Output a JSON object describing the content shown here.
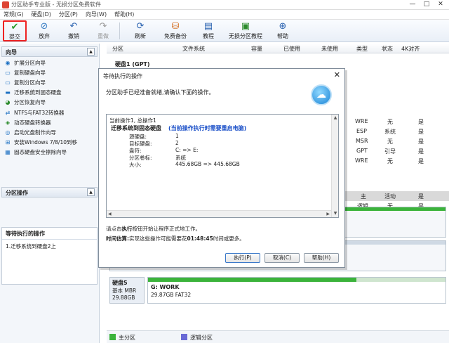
{
  "window": {
    "title": "分区助手专业版 - 无损分区免费软件",
    "controls": [
      "—",
      "□",
      "✕"
    ]
  },
  "menu": [
    "常规(G)",
    "硬盘(D)",
    "分区(P)",
    "向导(W)",
    "帮助(H)"
  ],
  "toolbar": {
    "commit": "提交",
    "discard": "放弃",
    "undo": "撤销",
    "redo": "重做",
    "refresh": "刷新",
    "free_backup": "免费备份",
    "tutorial": "教程",
    "lossless_tutorial": "无损分区教程",
    "help": "帮助"
  },
  "sidebar": {
    "wizard_title": "向导",
    "wizard_items": [
      "扩展分区向导",
      "复制硬盘向导",
      "复制分区向导",
      "迁移系统到固态硬盘",
      "分区恢复向导",
      "NTFS与FAT32转换器",
      "动态硬盘转换器",
      "启动光盘制作向导",
      "安装Windows 7/8/10到移",
      "固态硬盘安全擦除向导"
    ],
    "partition_ops_title": "分区操作",
    "pending_title": "等待执行的操作",
    "pending_items": [
      "1.迁移系统到硬盘2上"
    ]
  },
  "table": {
    "headers": [
      "分区",
      "文件系统",
      "容量",
      "已使用",
      "未使用",
      "类型",
      "状态",
      "4K对齐"
    ],
    "disk_label": "硬盘1 (GPT)",
    "rows": [
      [
        "WRE",
        "无",
        "是"
      ],
      [
        "ESP",
        "系统",
        "是"
      ],
      [
        "MSR",
        "无",
        "是"
      ],
      [
        "GPT",
        "引导",
        "是"
      ],
      [
        "WRE",
        "无",
        "是"
      ],
      [
        "",
        "",
        ""
      ],
      [
        "",
        "",
        ""
      ],
      [
        "主",
        "活动",
        "是"
      ],
      [
        "逻辑",
        "无",
        "是"
      ],
      [
        "",
        "",
        "是"
      ],
      [
        "",
        "",
        "是"
      ]
    ]
  },
  "disk5": {
    "name": "硬盘5",
    "type": "基本 MBR",
    "size": "29.88GB",
    "partition_name": "G: WORK",
    "partition_detail": "29.87GB FAT32"
  },
  "legend": {
    "primary": "主分区",
    "logical": "逻辑分区",
    "primary_color": "#3bb33b",
    "logical_color": "#6a6ad6"
  },
  "dialog": {
    "title": "等待执行的操作",
    "close": "✕",
    "message": "分区助手已经准备就绪,请确认下面的操作。",
    "ops_count": "当前操作1, 总操作1",
    "op_title": "迁移系统到固态硬盘",
    "op_warning": "(当前操作执行时需要重启电脑)",
    "details": [
      {
        "k": "源硬盘:",
        "v": "1"
      },
      {
        "k": "目标硬盘:",
        "v": "2"
      },
      {
        "k": "盘符:",
        "v": "C: => E:"
      },
      {
        "k": "分区卷标:",
        "v": "系统"
      },
      {
        "k": "大小:",
        "v": "445.68GB => 445.68GB"
      }
    ],
    "hint_pre": "请点击",
    "hint_bold": "执行",
    "hint_post": "按钮开始让程序正式地工作。",
    "est_label": "时间估算:",
    "est_pre": "实现这些操作可能需要花",
    "est_time": "01:48:45",
    "est_post": "时间或更多。",
    "btn_execute": "执行(P)",
    "btn_cancel": "取消(C)",
    "btn_help": "帮助(H)"
  }
}
